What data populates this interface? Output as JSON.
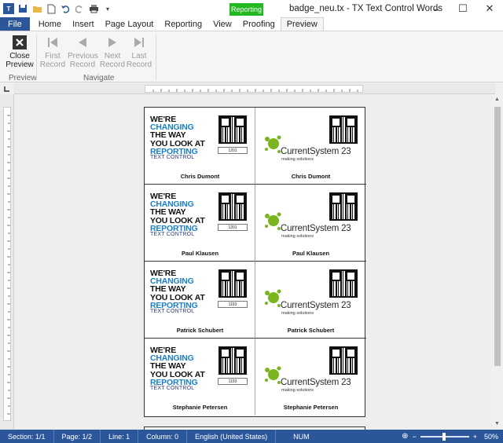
{
  "window": {
    "title": "badge_neu.tx - TX Text Control Words",
    "context_tab_group": "Reporting",
    "quick_access_icons": [
      "app-icon",
      "save-icon",
      "folder-icon",
      "new-document-icon",
      "undo-icon",
      "redo-icon",
      "print-icon",
      "chevron-down-icon"
    ]
  },
  "tabs": [
    "File",
    "Home",
    "Insert",
    "Page Layout",
    "Reporting",
    "View",
    "Proofing",
    "Preview"
  ],
  "active_tab": "Preview",
  "ribbon": {
    "close_preview": {
      "line1": "Close",
      "line2": "Preview"
    },
    "group_preview": "Preview",
    "first_record": {
      "line1": "First",
      "line2": "Record"
    },
    "previous_record": {
      "line1": "Previous",
      "line2": "Record"
    },
    "next_record": {
      "line1": "Next",
      "line2": "Record"
    },
    "last_record": {
      "line1": "Last",
      "line2": "Record"
    },
    "group_navigate": "Navigate"
  },
  "badges": [
    {
      "name": "Chris Dumont",
      "id": "1201"
    },
    {
      "name": "Paul Klausen",
      "id": "1201"
    },
    {
      "name": "Patrick Schubert",
      "id": "1193"
    },
    {
      "name": "Stephanie Petersen",
      "id": "1193"
    }
  ],
  "badge_text": {
    "slogan_1": "WE'RE",
    "slogan_2": "CHANGING",
    "slogan_3": "THE WAY",
    "slogan_4": "YOU LOOK AT",
    "slogan_5": "REPORTING",
    "tc_logo": "TEXT CONTROL",
    "cs_name": "CurrentSystem 23",
    "cs_sub": "making solutions"
  },
  "colors": {
    "brand_blue": "#2b579a",
    "reporting_green": "#22b822",
    "slogan_blue": "#1a7fc6",
    "cs_green": "#7ab51d"
  },
  "status": {
    "section": "Section: 1/1",
    "page": "Page: 1/2",
    "line": "Line: 1",
    "column": "Column: 0",
    "language": "English (United States)",
    "num": "NUM",
    "zoom": "50%"
  }
}
